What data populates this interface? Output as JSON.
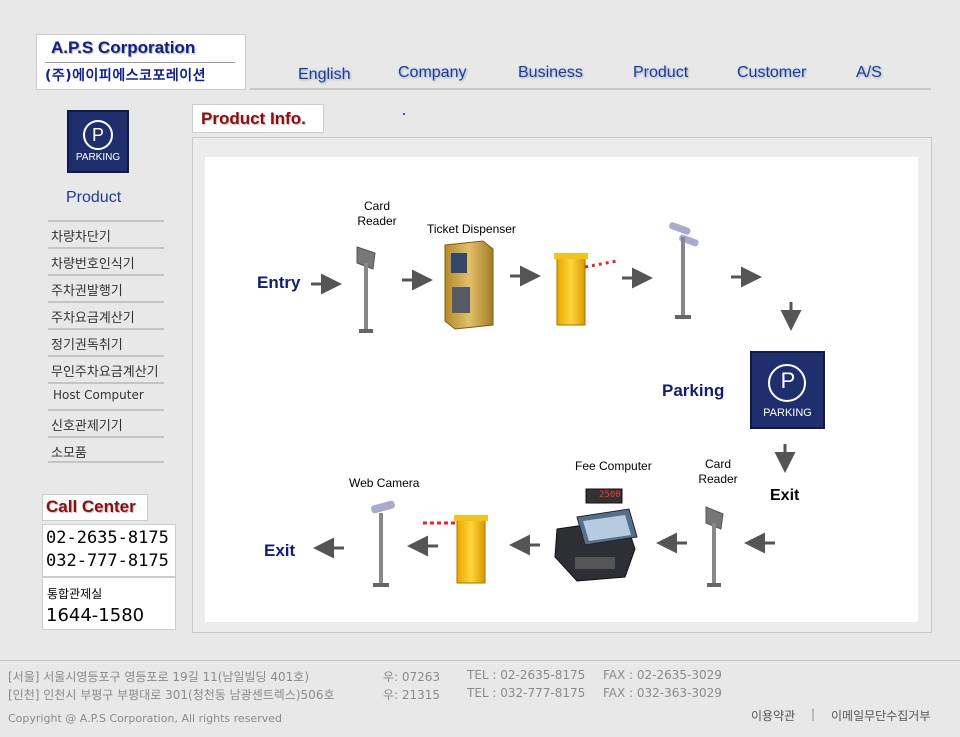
{
  "logo": {
    "en": "A.P.S Corporation",
    "ko": "(주)에이피에스코포레이션"
  },
  "nav": {
    "english": "English",
    "company": "Company",
    "business": "Business",
    "product": "Product",
    "customer": "Customer",
    "as": "A/S"
  },
  "sidebar": {
    "icon_text": "PARKING",
    "icon_letter": "P",
    "title": "Product",
    "items": [
      "차량차단기",
      "차량번호인식기",
      "주차권발행기",
      "주차요금계산기",
      "정기권독취기",
      "무인주차요금계산기",
      "Host Computer",
      "신호관제기기",
      "소모품"
    ]
  },
  "call_center": {
    "title": "Call Center",
    "phone1": "02-2635-8175",
    "phone2": "032-777-8175",
    "label": "통합관제실",
    "phone3": "1644-1580"
  },
  "product_info": {
    "title": "Product Info.",
    "diagram": {
      "entry": "Entry",
      "card_reader": "Card Reader",
      "ticket_dispenser": "Ticket Dispenser",
      "parking": "Parking",
      "parking_icon_text": "PARKING",
      "parking_icon_letter": "P",
      "exit_right": "Exit",
      "card_reader_2": "Card Reader",
      "fee_computer": "Fee Computer",
      "fee_display": "2500",
      "web_camera": "Web Camera",
      "exit_left": "Exit"
    }
  },
  "footer": {
    "seoul_addr": "[서울] 서울시영등포구 영등포로 19길 11(남일빌딩 401호)",
    "seoul_zip": "우: 07263",
    "seoul_tel": "TEL : 02-2635-8175",
    "seoul_fax": "FAX : 02-2635-3029",
    "incheon_addr": "[인천] 인천시 부평구 부평대로 301(청천동 남광센트렉스)506호",
    "incheon_zip": "우: 21315",
    "incheon_tel": "TEL : 032-777-8175",
    "incheon_fax": "FAX : 032-363-3029",
    "copyright": "Copyright @ A.P.S Corporation, All rights reserved",
    "terms": "이용약관",
    "separator": "|",
    "email_policy": "이메일무단수집거부"
  },
  "colors": {
    "brand_blue": "#12208a",
    "accent_red": "#8b0f0f",
    "nav_blue": "#1c3c9c",
    "parking_navy": "#1f2f6e"
  }
}
